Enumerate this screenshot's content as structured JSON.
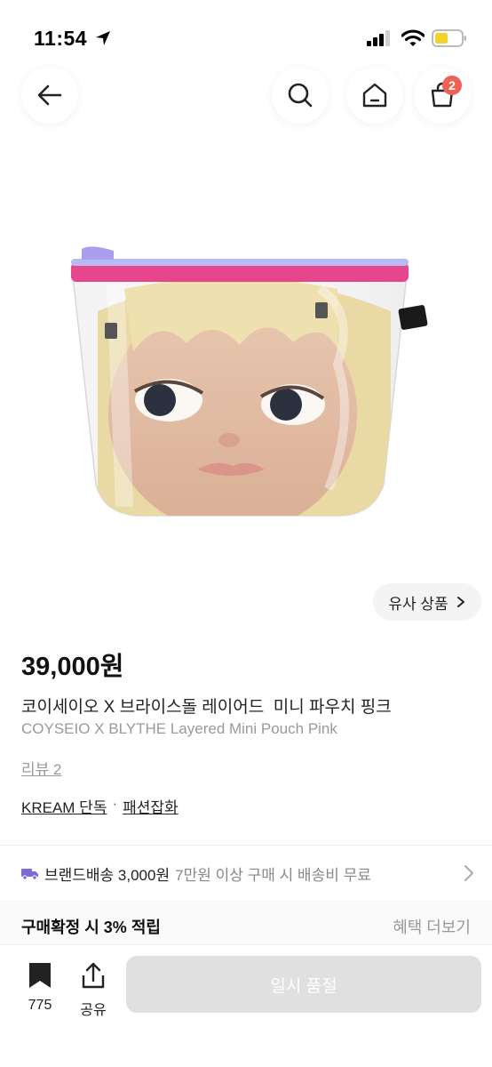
{
  "status_bar": {
    "time": "11:54"
  },
  "header": {
    "cart_count": "2"
  },
  "similar_button": {
    "label": "유사 상품"
  },
  "product": {
    "price": "39,000원",
    "title_ko": "코이세이오 X 브라이스돌 레이어드  미니 파우치 핑크",
    "title_en": "COYSEIO X BLYTHE Layered Mini Pouch Pink",
    "review_link": "리뷰 2",
    "tag_exclusive": "KREAM 단독",
    "tag_separator": "·",
    "tag_category": "패션잡화"
  },
  "shipping": {
    "main": "브랜드배송 3,000원",
    "sub": "7만원 이상 구매 시 배송비 무료"
  },
  "benefit": {
    "main": "구매확정 시 3% 적립",
    "more": "혜택 더보기"
  },
  "bottom_bar": {
    "bookmark_count": "775",
    "share_label": "공유",
    "cta_label": "일시 품절"
  },
  "colors": {
    "badge": "#ef6253",
    "shipping_icon": "#7c6bd6",
    "zipper_tape": "#e6478c",
    "zipper_pull": "#a99ef0"
  }
}
